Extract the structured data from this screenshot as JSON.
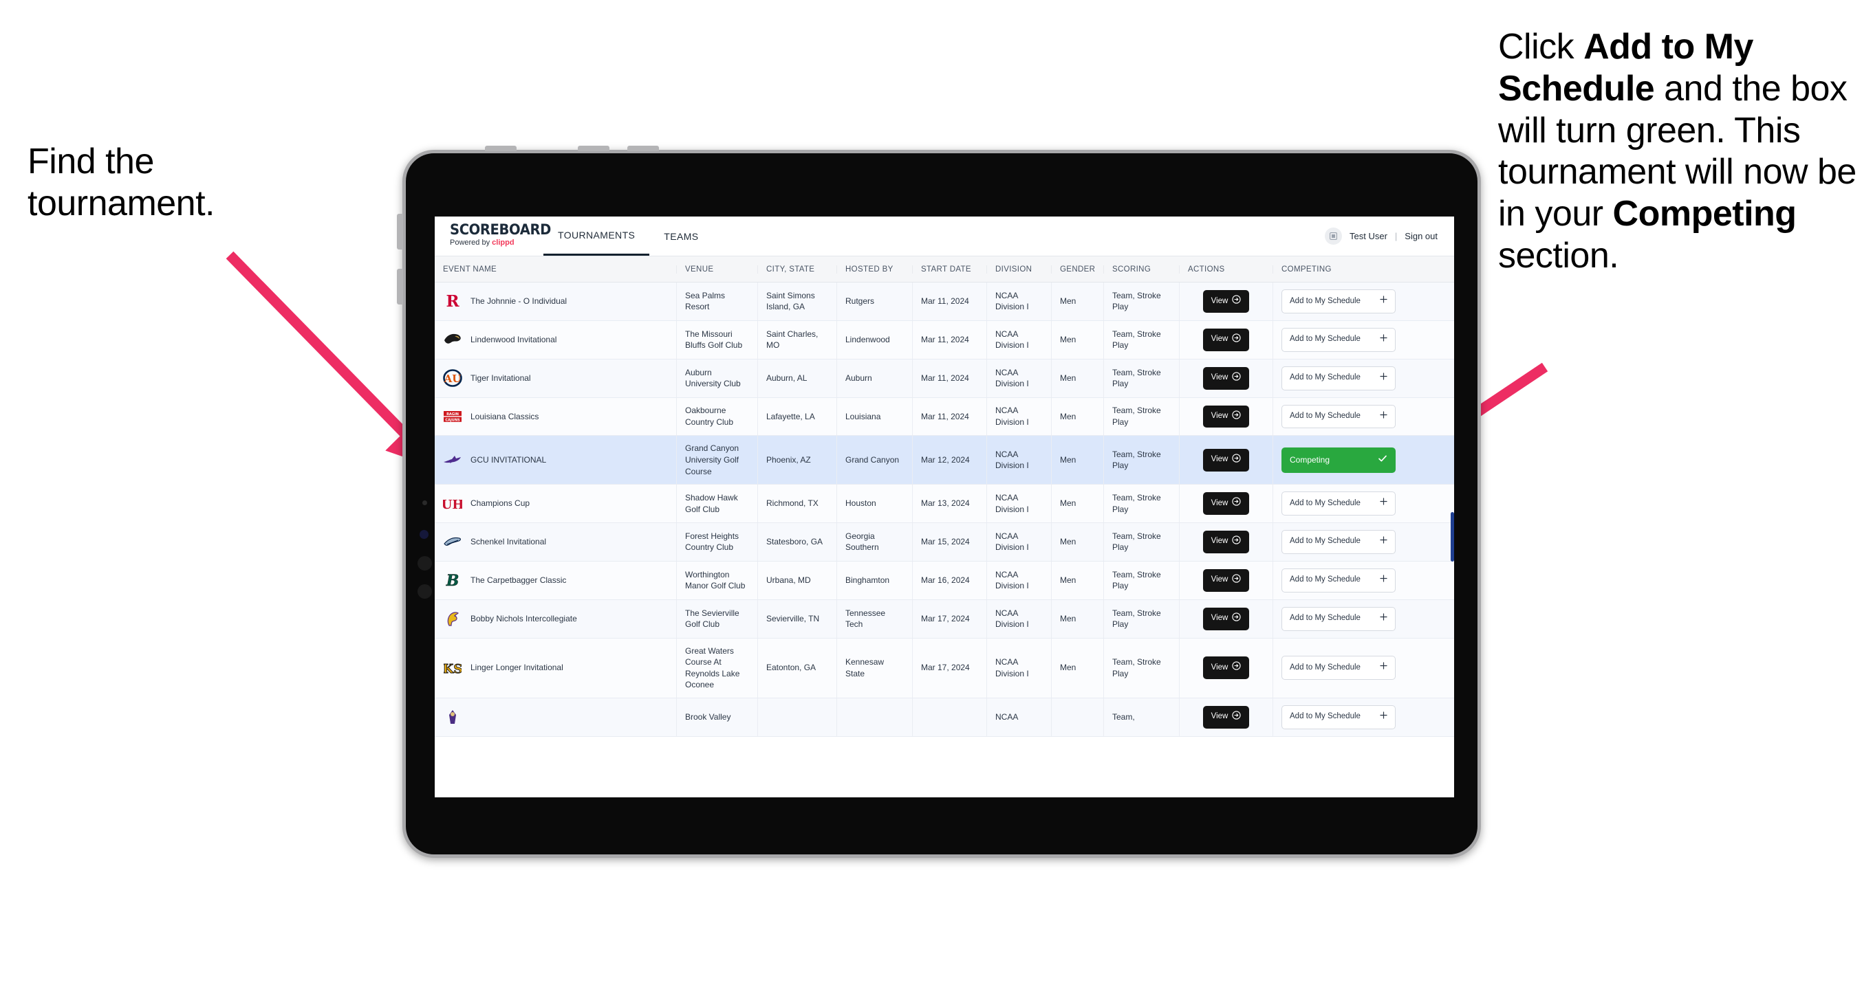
{
  "annotations": {
    "left": "Find the tournament.",
    "right_parts": [
      {
        "t": "Click ",
        "b": false
      },
      {
        "t": "Add to My Schedule",
        "b": true
      },
      {
        "t": " and the box will turn green. This tournament will now be in your ",
        "b": false
      },
      {
        "t": "Competing",
        "b": true
      },
      {
        "t": " section.",
        "b": false
      }
    ],
    "arrow_color": "#ED2D63"
  },
  "app": {
    "brand": {
      "name": "SCOREBOARD",
      "powered_prefix": "Powered by ",
      "powered_brand": "clippd"
    },
    "nav": [
      {
        "label": "TOURNAMENTS",
        "active": true
      },
      {
        "label": "TEAMS",
        "active": false
      }
    ],
    "user": {
      "avatar_icon": "user-badge-icon",
      "name": "Test User",
      "separator": "|",
      "signout": "Sign out"
    }
  },
  "table": {
    "columns": [
      "EVENT NAME",
      "VENUE",
      "CITY, STATE",
      "HOSTED BY",
      "START DATE",
      "DIVISION",
      "GENDER",
      "SCORING",
      "ACTIONS",
      "COMPETING"
    ],
    "view_label": "View",
    "add_label": "Add to My Schedule",
    "add_icon": "plus-icon",
    "competing_label": "Competing",
    "competing_icon": "check-icon",
    "view_icon": "arrow-circle-right-icon",
    "rows": [
      {
        "logo": "rutgers-r-logo",
        "event": "The Johnnie - O Individual",
        "venue": "Sea Palms Resort",
        "city": "Saint Simons Island, GA",
        "host": "Rutgers",
        "date": "Mar 11, 2024",
        "division": "NCAA Division I",
        "gender": "Men",
        "scoring": "Team, Stroke Play",
        "competing": false
      },
      {
        "logo": "lindenwood-lion-logo",
        "event": "Lindenwood Invitational",
        "venue": "The Missouri Bluffs Golf Club",
        "city": "Saint Charles, MO",
        "host": "Lindenwood",
        "date": "Mar 11, 2024",
        "division": "NCAA Division I",
        "gender": "Men",
        "scoring": "Team, Stroke Play",
        "competing": false
      },
      {
        "logo": "auburn-au-logo",
        "event": "Tiger Invitational",
        "venue": "Auburn University Club",
        "city": "Auburn, AL",
        "host": "Auburn",
        "date": "Mar 11, 2024",
        "division": "NCAA Division I",
        "gender": "Men",
        "scoring": "Team, Stroke Play",
        "competing": false
      },
      {
        "logo": "ragin-cajuns-logo",
        "event": "Louisiana Classics",
        "venue": "Oakbourne Country Club",
        "city": "Lafayette, LA",
        "host": "Louisiana",
        "date": "Mar 11, 2024",
        "division": "NCAA Division I",
        "gender": "Men",
        "scoring": "Team, Stroke Play",
        "competing": false
      },
      {
        "logo": "gcu-lope-logo",
        "event": "GCU INVITATIONAL",
        "venue": "Grand Canyon University Golf Course",
        "city": "Phoenix, AZ",
        "host": "Grand Canyon",
        "date": "Mar 12, 2024",
        "division": "NCAA Division I",
        "gender": "Men",
        "scoring": "Team, Stroke Play",
        "competing": true
      },
      {
        "logo": "houston-uh-logo",
        "event": "Champions Cup",
        "venue": "Shadow Hawk Golf Club",
        "city": "Richmond, TX",
        "host": "Houston",
        "date": "Mar 13, 2024",
        "division": "NCAA Division I",
        "gender": "Men",
        "scoring": "Team, Stroke Play",
        "competing": false
      },
      {
        "logo": "georgia-southern-eagle-logo",
        "event": "Schenkel Invitational",
        "venue": "Forest Heights Country Club",
        "city": "Statesboro, GA",
        "host": "Georgia Southern",
        "date": "Mar 15, 2024",
        "division": "NCAA Division I",
        "gender": "Men",
        "scoring": "Team, Stroke Play",
        "competing": false
      },
      {
        "logo": "binghamton-b-logo",
        "event": "The Carpetbagger Classic",
        "venue": "Worthington Manor Golf Club",
        "city": "Urbana, MD",
        "host": "Binghamton",
        "date": "Mar 16, 2024",
        "division": "NCAA Division I",
        "gender": "Men",
        "scoring": "Team, Stroke Play",
        "competing": false
      },
      {
        "logo": "tennessee-tech-eagle-logo",
        "event": "Bobby Nichols Intercollegiate",
        "venue": "The Sevierville Golf Club",
        "city": "Sevierville, TN",
        "host": "Tennessee Tech",
        "date": "Mar 17, 2024",
        "division": "NCAA Division I",
        "gender": "Men",
        "scoring": "Team, Stroke Play",
        "competing": false
      },
      {
        "logo": "kennesaw-state-ks-logo",
        "event": "Linger Longer Invitational",
        "venue": "Great Waters Course At Reynolds Lake Oconee",
        "city": "Eatonton, GA",
        "host": "Kennesaw State",
        "date": "Mar 17, 2024",
        "division": "NCAA Division I",
        "gender": "Men",
        "scoring": "Team, Stroke Play",
        "competing": false
      },
      {
        "logo": "ecu-pirate-logo",
        "event": "",
        "venue": "Brook Valley",
        "city": "",
        "host": "",
        "date": "",
        "division": "NCAA",
        "gender": "",
        "scoring": "Team,",
        "competing": false
      }
    ]
  }
}
